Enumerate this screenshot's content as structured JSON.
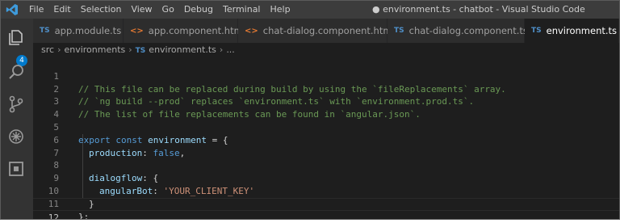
{
  "menu": [
    "File",
    "Edit",
    "Selection",
    "View",
    "Go",
    "Debug",
    "Terminal",
    "Help"
  ],
  "window_title": "● environment.ts - chatbot - Visual Studio Code",
  "activity": {
    "explorer_badge": "4"
  },
  "tabs": [
    {
      "kind": "TS",
      "label": "app.module.ts",
      "state": "●"
    },
    {
      "kind": "<>",
      "label": "app.component.html",
      "state": "●"
    },
    {
      "kind": "<>",
      "label": "chat-dialog.component.html",
      "state": "●"
    },
    {
      "kind": "TS",
      "label": "chat-dialog.component.ts",
      "state": "●"
    },
    {
      "kind": "TS",
      "label": "environment.ts",
      "state": "×"
    }
  ],
  "breadcrumb": {
    "parts": [
      "src",
      "environments",
      "environment.ts",
      "..."
    ],
    "file_kind": "TS"
  },
  "editor": {
    "lines": [
      {
        "n": "1",
        "comment": "// This file can be replaced during build by using the `fileReplacements` array."
      },
      {
        "n": "2",
        "comment": "// `ng build --prod` replaces `environment.ts` with `environment.prod.ts`."
      },
      {
        "n": "3",
        "comment": "// The list of file replacements can be found in `angular.json`."
      },
      {
        "n": "4"
      },
      {
        "n": "5",
        "kw1": "export",
        "kw2": "const",
        "name": "environment",
        "rest": " = {"
      },
      {
        "n": "6",
        "prop": "production",
        "colon": ": ",
        "val": "false",
        "end": ","
      },
      {
        "n": "7"
      },
      {
        "n": "8",
        "prop": "dialogflow",
        "colon": ": {"
      },
      {
        "n": "9",
        "prop": "angularBot",
        "colon": ": ",
        "str": "'YOUR_CLIENT_KEY'"
      },
      {
        "n": "10",
        "text": "}"
      },
      {
        "n": "11",
        "text": "};"
      },
      {
        "n": "12"
      }
    ]
  }
}
